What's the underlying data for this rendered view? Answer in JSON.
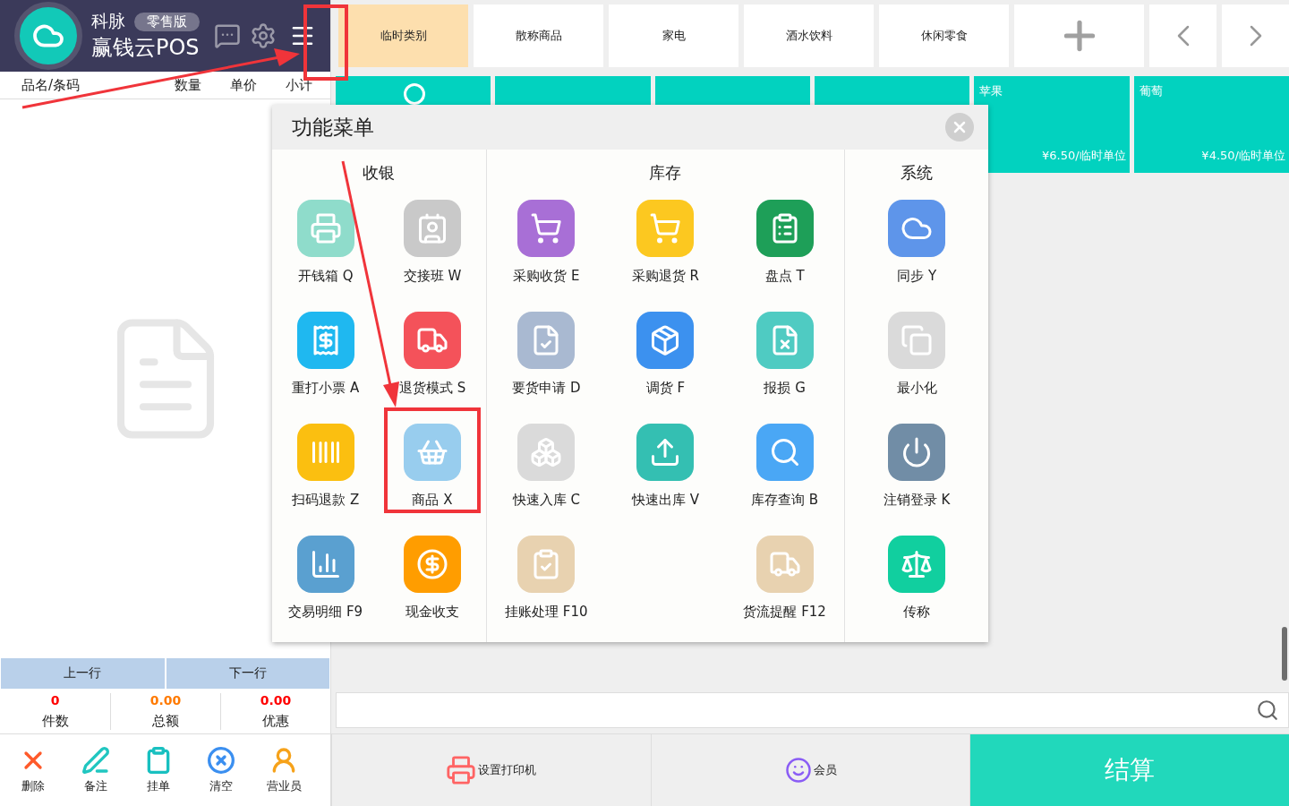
{
  "header": {
    "brand": "科脉",
    "edition": "零售版",
    "product": "赢钱云POS",
    "menu_annotated": true
  },
  "order_columns": [
    "品名/条码",
    "数量",
    "单价",
    "小计"
  ],
  "nav": [
    "上一行",
    "下一行"
  ],
  "totals": [
    {
      "value": "0",
      "label": "件数",
      "color": "#ff0000"
    },
    {
      "value": "0.00",
      "label": "总额",
      "color": "#ff7a00"
    },
    {
      "value": "0.00",
      "label": "优惠",
      "color": "#ff0000"
    }
  ],
  "tools": [
    {
      "kind": "delete",
      "label": "删除"
    },
    {
      "kind": "note",
      "label": "备注"
    },
    {
      "kind": "hold",
      "label": "挂单"
    },
    {
      "kind": "clear",
      "label": "清空"
    },
    {
      "kind": "clerk",
      "label": "营业员"
    }
  ],
  "categories": [
    {
      "label": "临时类别",
      "selected": true
    },
    {
      "label": "散称商品",
      "selected": false
    },
    {
      "label": "家电",
      "selected": false
    },
    {
      "label": "酒水饮料",
      "selected": false
    },
    {
      "label": "休闲零食",
      "selected": false
    }
  ],
  "products": [
    {
      "kind": "icon"
    },
    {
      "kind": "covered"
    },
    {
      "kind": "covered"
    },
    {
      "kind": "covered"
    },
    {
      "kind": "item",
      "name": "苹果",
      "price": "¥6.50/临时单位"
    },
    {
      "kind": "item",
      "name": "葡萄",
      "price": "¥4.50/临时单位"
    }
  ],
  "actions": [
    {
      "kind": "printer",
      "label": "设置打印机"
    },
    {
      "kind": "member",
      "label": "会员"
    },
    {
      "kind": "checkout",
      "label": "结算"
    }
  ],
  "menu": {
    "title": "功能菜单",
    "sections": [
      {
        "title": "收银",
        "items": [
          {
            "kind": "cash-drawer",
            "label": "开钱箱 Q",
            "annotated": false
          },
          {
            "kind": "shift",
            "label": "交接班 W",
            "annotated": false
          },
          {
            "kind": "reprint",
            "label": "重打小票 A",
            "annotated": false
          },
          {
            "kind": "return-mode",
            "label": "退货模式 S",
            "annotated": false
          },
          {
            "kind": "scan-refund",
            "label": "扫码退款 Z",
            "annotated": false
          },
          {
            "kind": "goods",
            "label": "商品 X",
            "annotated": true
          },
          {
            "kind": "transactions",
            "label": "交易明细 F9",
            "annotated": false
          },
          {
            "kind": "cash",
            "label": "现金收支",
            "annotated": false
          }
        ]
      },
      {
        "title": "库存",
        "items": [
          {
            "kind": "purchase",
            "label": "采购收货 E",
            "annotated": false
          },
          {
            "kind": "return-purchase",
            "label": "采购退货 R",
            "annotated": false
          },
          {
            "kind": "stocktake",
            "label": "盘点 T",
            "annotated": false
          },
          {
            "kind": "request",
            "label": "要货申请 D",
            "annotated": false
          },
          {
            "kind": "transfer",
            "label": "调货 F",
            "annotated": false
          },
          {
            "kind": "loss",
            "label": "报损 G",
            "annotated": false
          },
          {
            "kind": "quick-in",
            "label": "快速入库 C",
            "annotated": false
          },
          {
            "kind": "quick-out",
            "label": "快速出库 V",
            "annotated": false
          },
          {
            "kind": "stock-query",
            "label": "库存查询 B",
            "annotated": false
          },
          {
            "kind": "credit",
            "label": "挂账处理 F10",
            "annotated": false
          },
          {
            "kind": "spacer"
          },
          {
            "kind": "alert",
            "label": "货流提醒 F12",
            "annotated": false
          }
        ]
      },
      {
        "title": "系统",
        "items": [
          {
            "kind": "sync",
            "label": "同步 Y",
            "annotated": false
          },
          {
            "kind": "minimize",
            "label": "最小化",
            "annotated": false
          },
          {
            "kind": "logout",
            "label": "注销登录 K",
            "annotated": false
          },
          {
            "kind": "scale",
            "label": "传称",
            "annotated": false
          }
        ]
      }
    ]
  }
}
